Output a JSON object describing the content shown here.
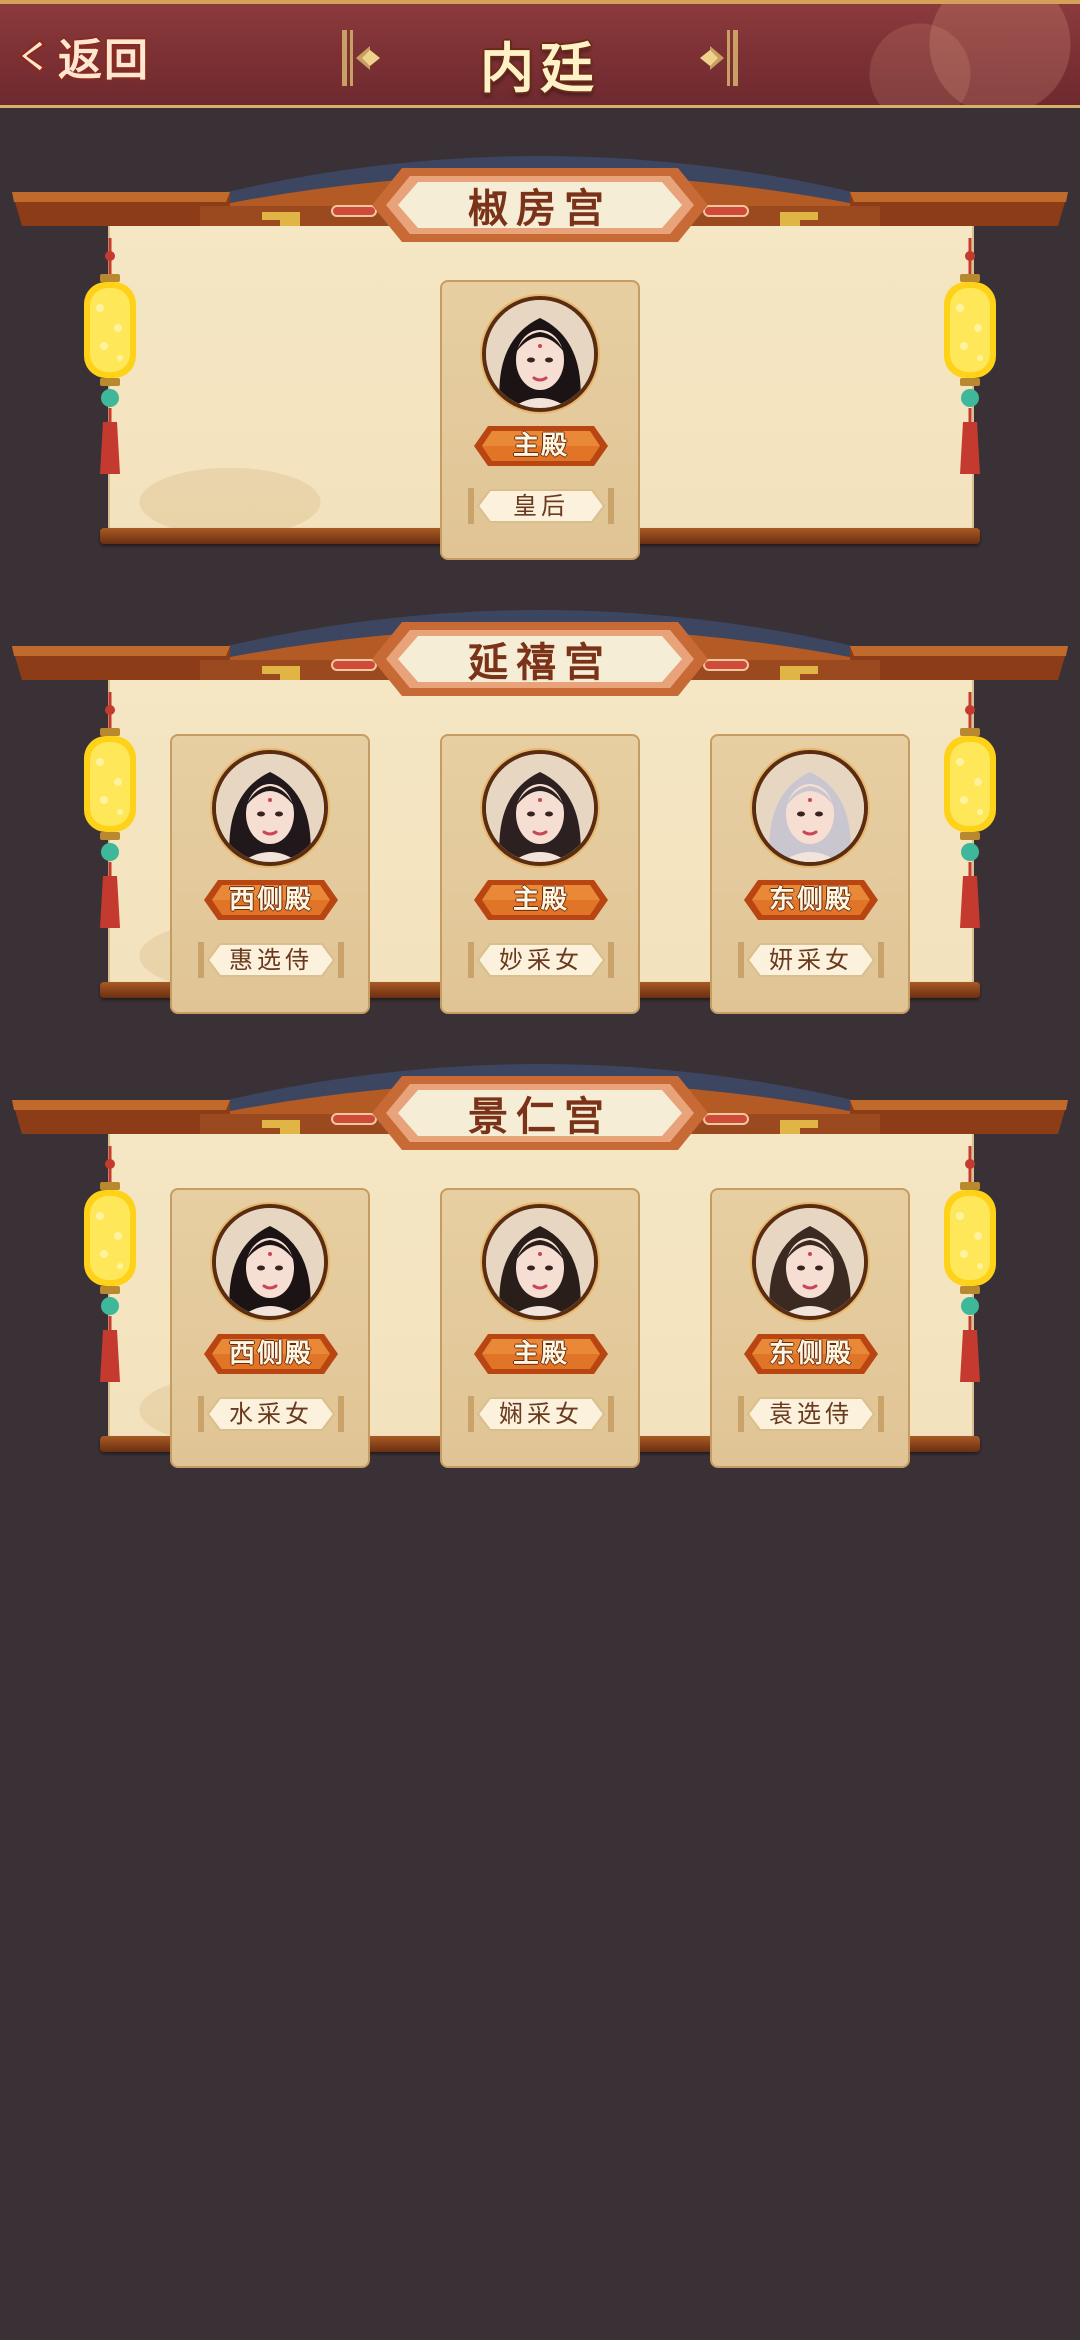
{
  "header": {
    "back_label": "返回",
    "title": "内廷"
  },
  "palaces": [
    {
      "name": "椒房宫",
      "consorts": [
        {
          "hall": "主殿",
          "rank": "皇后",
          "slot": "center"
        }
      ]
    },
    {
      "name": "延禧宫",
      "consorts": [
        {
          "hall": "西侧殿",
          "rank": "惠选侍",
          "slot": "left"
        },
        {
          "hall": "主殿",
          "rank": "妙采女",
          "slot": "center"
        },
        {
          "hall": "东侧殿",
          "rank": "妍采女",
          "slot": "right"
        }
      ]
    },
    {
      "name": "景仁宫",
      "consorts": [
        {
          "hall": "西侧殿",
          "rank": "水采女",
          "slot": "left"
        },
        {
          "hall": "主殿",
          "rank": "娴采女",
          "slot": "center"
        },
        {
          "hall": "东侧殿",
          "rank": "袁选侍",
          "slot": "right"
        }
      ]
    }
  ],
  "colors": {
    "background": "#3a3136",
    "header": "#7a2f33",
    "scroll": "#f5e6c4",
    "card": "#e7cfa2",
    "badge": "#d8651f",
    "lantern": "#ffd21a"
  }
}
